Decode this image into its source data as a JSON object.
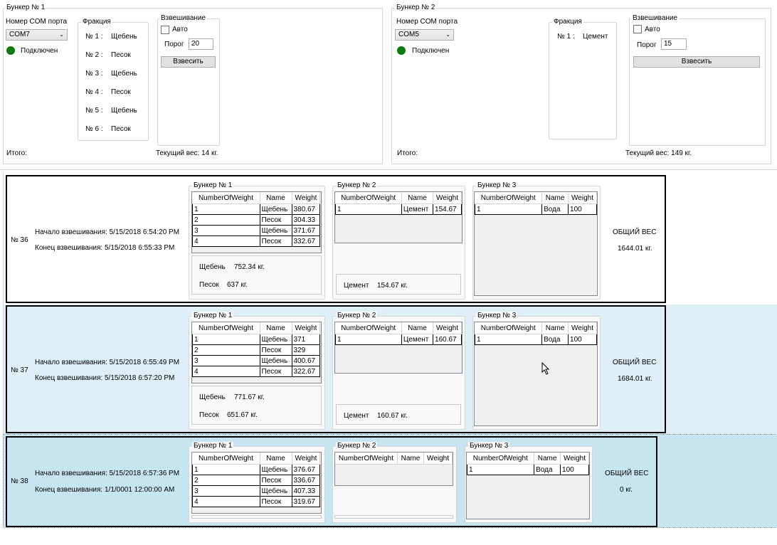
{
  "bunker1": {
    "title": "Бункер № 1",
    "com_label": "Номер COM порта",
    "com_value": "COM7",
    "status": "Подключен",
    "fraction_title": "Фракция",
    "fractions": [
      {
        "no": "№ 1 :",
        "name": "Щебень"
      },
      {
        "no": "№ 2 :",
        "name": "Песок"
      },
      {
        "no": "№ 3 :",
        "name": "Щебень"
      },
      {
        "no": "№ 4 :",
        "name": "Песок"
      },
      {
        "no": "№ 5 :",
        "name": "Щебень"
      },
      {
        "no": "№ 6 :",
        "name": "Песок"
      }
    ],
    "weigh_title": "Взвешивание",
    "auto_label": "Авто",
    "threshold_label": "Порог",
    "threshold_value": "20",
    "weigh_button": "Взвесить",
    "total_label": "Итого:",
    "current_weight": "Текущий вес: 14 кг."
  },
  "bunker2": {
    "title": "Бункер № 2",
    "com_label": "Номер COM порта",
    "com_value": "COM5",
    "status": "Подключен",
    "fraction_title": "Фракция",
    "fractions": [
      {
        "no": "№ 1 :",
        "name": "Цемент"
      }
    ],
    "weigh_title": "Взвешивание",
    "auto_label": "Авто",
    "threshold_label": "Порог",
    "threshold_value": "15",
    "weigh_button": "Взвесить",
    "total_label": "Итого:",
    "current_weight": "Текущий вес: 149 кг."
  },
  "grid_headers": {
    "num": "NumberOfWeight",
    "name": "Name",
    "weight": "Weight"
  },
  "records": [
    {
      "number": "№ 36",
      "start": "Начало взвешивания: 5/15/2018 6:54:20 PM",
      "end": "Конец взвешивания: 5/15/2018 6:55:33 PM",
      "total_label": "ОБЩИЙ ВЕС",
      "total_value": "1644.01 кг.",
      "b1_title": "Бункер № 1",
      "b1_rows": [
        [
          "1",
          "Щебень",
          "380.67"
        ],
        [
          "2",
          "Песок",
          "304.33"
        ],
        [
          "3",
          "Щебень",
          "371.67"
        ],
        [
          "4",
          "Песок",
          "332.67"
        ]
      ],
      "b1_sums": [
        {
          "name": "Щебень",
          "value": "752.34 кг."
        },
        {
          "name": "Песок",
          "value": "637 кг."
        }
      ],
      "b2_title": "Бункер № 2",
      "b2_rows": [
        [
          "1",
          "Цемент",
          "154.67"
        ]
      ],
      "b2_sums": [
        {
          "name": "Цемент",
          "value": "154.67 кг."
        }
      ],
      "b3_title": "Бункер № 3",
      "b3_rows": [
        [
          "1",
          "Вода",
          "100"
        ]
      ]
    },
    {
      "number": "№ 37",
      "start": "Начало взвешивания: 5/15/2018 6:55:49 PM",
      "end": "Конец взвешивания: 5/15/2018 6:57:20 PM",
      "total_label": "ОБЩИЙ ВЕС",
      "total_value": "1684.01 кг.",
      "b1_title": "Бункер № 1",
      "b1_rows": [
        [
          "1",
          "Щебень",
          "371"
        ],
        [
          "2",
          "Песок",
          "329"
        ],
        [
          "3",
          "Щебень",
          "400.67"
        ],
        [
          "4",
          "Песок",
          "322.67"
        ]
      ],
      "b1_sums": [
        {
          "name": "Щебень",
          "value": "771.67 кг."
        },
        {
          "name": "Песок",
          "value": "651.67 кг."
        }
      ],
      "b2_title": "Бункер № 2",
      "b2_rows": [
        [
          "1",
          "Цемент",
          "160.67"
        ]
      ],
      "b2_sums": [
        {
          "name": "Цемент",
          "value": "160.67 кг."
        }
      ],
      "b3_title": "Бункер № 3",
      "b3_rows": [
        [
          "1",
          "Вода",
          "100"
        ]
      ]
    },
    {
      "number": "№ 38",
      "start": "Начало взвешивания: 5/15/2018 6:57:36 PM",
      "end": "Конец взвешивания: 1/1/0001 12:00:00 AM",
      "total_label": "ОБЩИЙ ВЕС",
      "total_value": "0 кг.",
      "b1_title": "Бункер № 1",
      "b1_rows": [
        [
          "1",
          "Щебень",
          "376.67"
        ],
        [
          "2",
          "Песок",
          "336.67"
        ],
        [
          "3",
          "Щебень",
          "407.33"
        ],
        [
          "4",
          "Песок",
          "319.67"
        ]
      ],
      "b1_sums": [],
      "b2_title": "Бункер № 2",
      "b2_rows": [],
      "b2_sums": [],
      "b3_title": "Бункер № 3",
      "b3_rows": [
        [
          "1",
          "Вода",
          "100"
        ]
      ]
    }
  ],
  "colors": {
    "connected": "#0a7a0a",
    "selected_row": "#dfeff7",
    "active_row": "#c7e5f1"
  }
}
